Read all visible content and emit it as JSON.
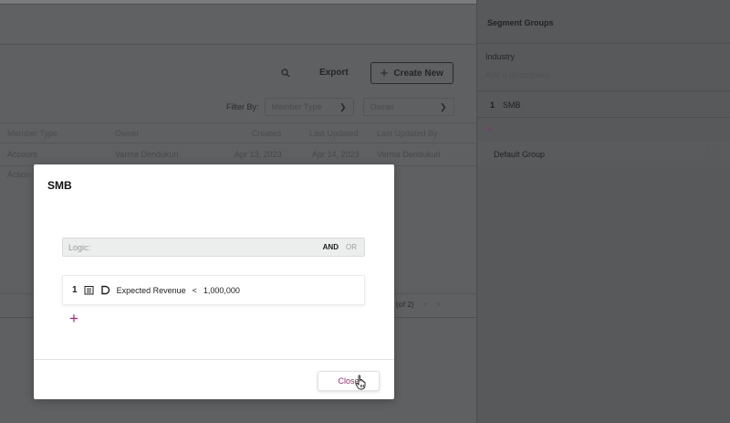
{
  "toolbar": {
    "search_icon": "search-icon",
    "export_label": "Export",
    "create_label": "Create New"
  },
  "filters": {
    "label": "Filter By:",
    "member_type_placeholder": "Member Type",
    "owner_placeholder": "Owner"
  },
  "table": {
    "headers": [
      "Member Type",
      "Owner",
      "Created",
      "Last Updated",
      "Last Updated By"
    ],
    "rows": [
      {
        "member_type": "Account",
        "owner": "Varma Dendukuri",
        "created": "Apr 13, 2023",
        "last_updated": "Apr 14, 2023",
        "last_updated_by": "Varma Dendukuri"
      }
    ],
    "partial_row_text": "Action",
    "pager_text": "(of 2)"
  },
  "right_panel": {
    "title": "Segment Groups",
    "segment_name": "Industry",
    "description_placeholder": "Add a description",
    "groups": [
      {
        "number": "1",
        "label": "SMB"
      }
    ],
    "default_group": "Default Group"
  },
  "modal": {
    "title": "SMB",
    "logic_label": "Logic:",
    "logic_and": "AND",
    "logic_or": "OR",
    "condition": {
      "number": "1",
      "field": "Expected Revenue",
      "operator": "<",
      "value": "1,000,000"
    },
    "close_label": "Close"
  },
  "colors": {
    "accent": "#9b2a6d",
    "overlay": "#5d5e60"
  }
}
